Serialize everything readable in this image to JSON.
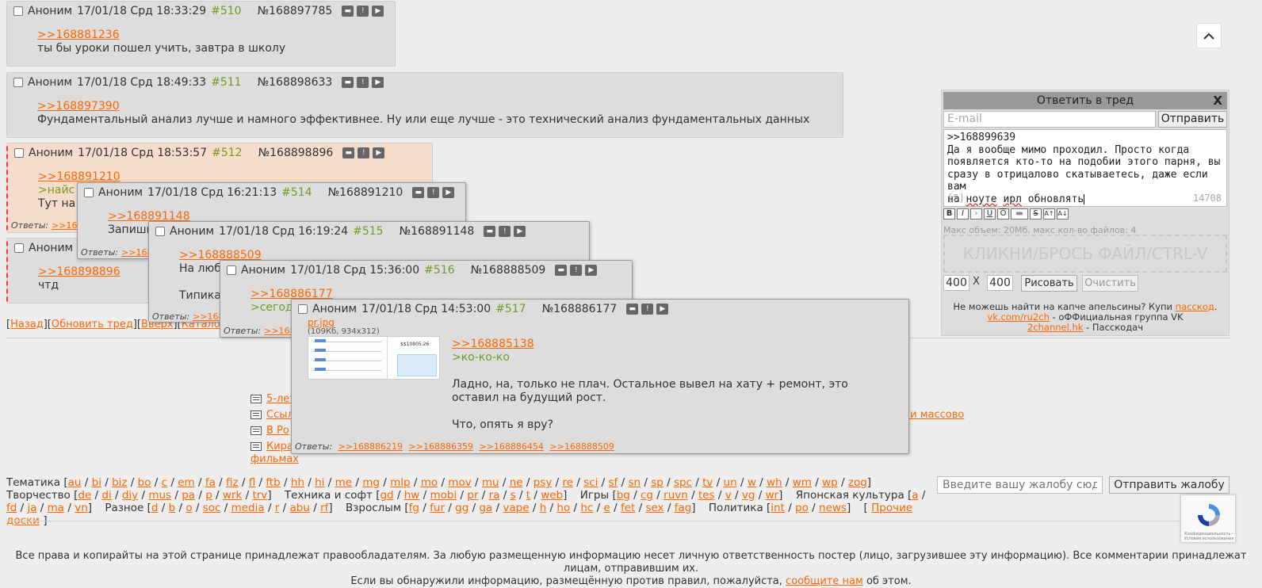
{
  "posts": {
    "p510": {
      "name": "Аноним",
      "date": "17/01/18 Срд 18:33:29",
      "num": "#510",
      "postno": "№168897785",
      "reply_link": ">>168881236",
      "text": [
        "ты бы уроки пошел учить, завтра в школу"
      ]
    },
    "p511": {
      "name": "Аноним",
      "date": "17/01/18 Срд 18:49:33",
      "num": "#511",
      "postno": "№168898633",
      "reply_link": ">>168897390",
      "text": [
        "Фундаментальный анализ лучше и намного эффективнее. Ну или еще лучше - это технический анализ фундаментальных данных"
      ]
    },
    "p512": {
      "name": "Аноним",
      "date": "17/01/18 Срд 18:53:57",
      "num": "#512",
      "postno": "№168898896",
      "reply_link": ">>168891210",
      "greentext": ">найс",
      "text": [
        "Тут на"
      ],
      "answers_label": "Ответы:",
      "answers": [
        ">>168"
      ]
    },
    "p513": {
      "name": "Аноним 1",
      "reply_link": ">>168898896",
      "text": [
        "чтд"
      ]
    },
    "p514": {
      "name": "Аноним",
      "date": "17/01/18 Срд 16:21:13",
      "num": "#514",
      "postno": "№168891210",
      "reply_link": ">>168891148",
      "text": [
        "Запиши"
      ],
      "answers_label": "Ответы:",
      "answers": [
        ">>168"
      ]
    },
    "p515": {
      "name": "Аноним",
      "date": "17/01/18 Срд 16:19:24",
      "num": "#515",
      "postno": "№168891148",
      "reply_link": ">>168888509",
      "text": [
        "На люб",
        "",
        "Типика"
      ],
      "answers_label": "Ответы:",
      "answers": [
        ">>168"
      ]
    },
    "p516": {
      "name": "Аноним",
      "date": "17/01/18 Срд 15:36:00",
      "num": "#516",
      "postno": "№168888509",
      "reply_link": ">>168886177",
      "greentext": ">сегод",
      "answers_label": "Ответы:",
      "answers": [
        ">>168"
      ]
    },
    "p517": {
      "name": "Аноним",
      "date": "17/01/18 Срд 14:53:00",
      "num": "#517",
      "postno": "№168886177",
      "file_name": "pr.jpg",
      "file_info": "(109Кб, 934x312)",
      "thumb_price": "$$10805.26",
      "reply_link": ">>168885138",
      "greentext": ">ко-ко-ко",
      "text": [
        "Ладно, на, только не плач. Остальное вывел на хату + ремонт, это",
        "оставил на будущий рост.",
        "",
        "Что, опять я вру?"
      ],
      "answers_label": "Ответы:",
      "answers": [
        ">>168886219",
        ">>168886359",
        ">>168886454",
        ">>168888509"
      ]
    }
  },
  "nav": {
    "back": "Назад",
    "refresh": "Обновить тред",
    "up": "Вверх",
    "catalog": "Каталог"
  },
  "news": [
    {
      "text": "5-лет"
    },
    {
      "text": "Ссыл",
      "tail": "е и массово"
    },
    {
      "text": "В Ро"
    },
    {
      "text": "Кира",
      "tail2": "фильмах"
    }
  ],
  "boards": {
    "cat1": {
      "label": "Тематика",
      "items": [
        "au",
        "bi",
        "biz",
        "bo",
        "c",
        "em",
        "fa",
        "fiz",
        "fl",
        "ftb",
        "hh",
        "hi",
        "me",
        "mg",
        "mlp",
        "mo",
        "mov",
        "mu",
        "ne",
        "psy",
        "re",
        "sci",
        "sf",
        "sn",
        "sp",
        "spc",
        "tv",
        "un",
        "w",
        "wh",
        "wm",
        "wp",
        "zog"
      ]
    },
    "cat2": {
      "label": "Творчество",
      "items": [
        "de",
        "di",
        "diy",
        "mus",
        "pa",
        "p",
        "wrk",
        "trv"
      ]
    },
    "cat3": {
      "label": "Техника и софт",
      "items": [
        "gd",
        "hw",
        "mobi",
        "pr",
        "ra",
        "s",
        "t",
        "web"
      ]
    },
    "cat4": {
      "label": "Игры",
      "items": [
        "bg",
        "cg",
        "ruvn",
        "tes",
        "v",
        "vg",
        "wr"
      ]
    },
    "cat5": {
      "label": "Японская культура",
      "items": [
        "a",
        "fd",
        "ja",
        "ma",
        "vn"
      ]
    },
    "cat6": {
      "label": "Разное",
      "items": [
        "d",
        "b",
        "o",
        "soc",
        "media",
        "r",
        "abu",
        "rf"
      ]
    },
    "cat7": {
      "label": "Взрослым",
      "items": [
        "fg",
        "fur",
        "gg",
        "ga",
        "vape",
        "h",
        "ho",
        "hc",
        "e",
        "fet",
        "sex",
        "fag"
      ]
    },
    "cat8": {
      "label": "Политика",
      "items": [
        "int",
        "po",
        "news"
      ]
    },
    "other": "Прочие доски"
  },
  "complaint": {
    "placeholder": "Введите вашу жалобу сюд",
    "button": "Отправить жалобу"
  },
  "recaptcha": {
    "privacy": "Конфиденциальность - Условия использования"
  },
  "footer": {
    "line1": "Все права и копирайты на этой странице принадлежат правообладателям. За любую размещенную информацию несет личную ответственность постер (лицо, загрузившее эту информацию). Все комментарии принадлежат лицам, отправившим их.",
    "line2_a": "Если вы обнаружили информацию, размещённую против правил, пожалуйста,",
    "line2_link": "сообщите нам",
    "line2_b": "об этом."
  },
  "quick_reply": {
    "title": "Ответить в тред",
    "close": "X",
    "email_placeholder": "E-mail",
    "send": "Отправить",
    "text_lines": [
      ">>168899639",
      "Да я вообще мимо проходил. Просто когда",
      "появляется кто-то на подобии этого парня, вы",
      "сразу в отрицалово скатываетесь, даже если вам"
    ],
    "last_line_a": "на ",
    "last_line_sp1": "ноуте",
    "last_line_b": " ",
    "last_line_sp2": "ирл",
    "last_line_c": " обновлять",
    "spoiler_hint": "[S]",
    "counter": "14708",
    "markup": [
      "B",
      "I",
      "›",
      "U",
      "O",
      "▬",
      "S",
      "A↑",
      "A↓"
    ],
    "limits": "Макс объем: 20Мб, макс кол-во файлов: 4",
    "drop": "КЛИКНИ/БРОСЬ ФАЙЛ/CTRL-V",
    "width": "400",
    "x": "X",
    "height": "400",
    "draw": "Рисовать",
    "clear": "Очистить",
    "promo1_a": "Не можешь найти на капче апельсины? Купи",
    "promo1_link": "пасскод",
    "promo1_b": ".",
    "promo2_link": "vk.com/ru2ch",
    "promo2_b": " - оФФициальная группа VK",
    "promo3_link": "2channel.hk",
    "promo3_b": " - Пасскодач"
  }
}
